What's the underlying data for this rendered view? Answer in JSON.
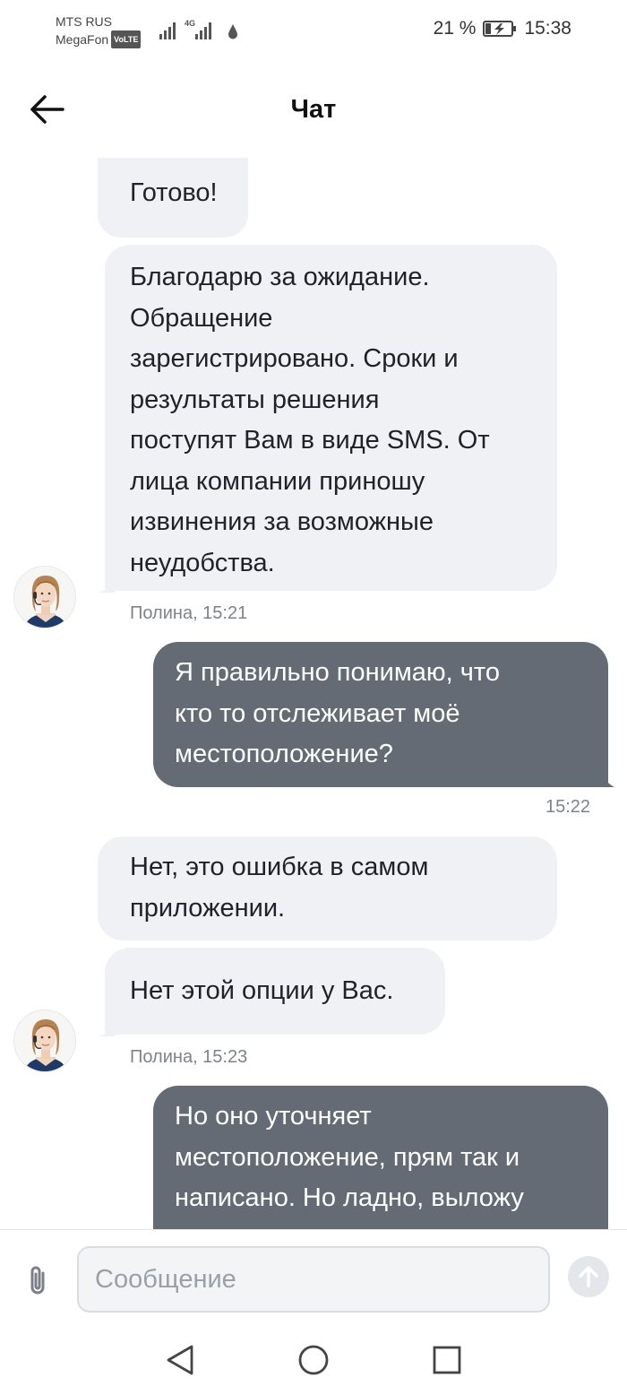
{
  "status_bar": {
    "carrier_1": "MTS RUS",
    "carrier_2": "MegaFon",
    "volte_badge": "VoLTE",
    "network_type": "4G",
    "battery_percent": "21 %",
    "time": "15:38"
  },
  "header": {
    "title": "Чат",
    "back_icon": "arrow-left-icon"
  },
  "messages": [
    {
      "direction": "in",
      "text": "Готово!"
    },
    {
      "direction": "in",
      "text": "Благодарю за ожидание.\nОбращение\nзарегистрировано. Сроки и\nрезультаты решения\nпоступят Вам в виде SMS. От\nлица компании приношу\nизвинения за возможные\nнеудобства.",
      "meta": "Полина, 15:21"
    },
    {
      "direction": "out",
      "text": "Я правильно понимаю, что\nкто то отслеживает моё\nместоположение?",
      "meta": "15:22"
    },
    {
      "direction": "in",
      "text": "Нет, это ошибка в самом\nприложении."
    },
    {
      "direction": "in",
      "text": "Нет этой опции у Вас.",
      "meta": "Полина, 15:23"
    },
    {
      "direction": "out",
      "text": "Но оно уточняет\nместоположение, прям так и\nнаписано. Но ладно, выложу"
    }
  ],
  "composer": {
    "placeholder": "Сообщение",
    "attach_icon": "paperclip-icon",
    "send_icon": "arrow-up-icon"
  },
  "nav_bar": {
    "back_icon": "triangle-back-icon",
    "home_icon": "circle-home-icon",
    "recents_icon": "square-recents-icon"
  },
  "colors": {
    "incoming_bubble": "#f0f1f5",
    "outgoing_bubble": "#646b74",
    "meta_text": "#7d828b"
  }
}
